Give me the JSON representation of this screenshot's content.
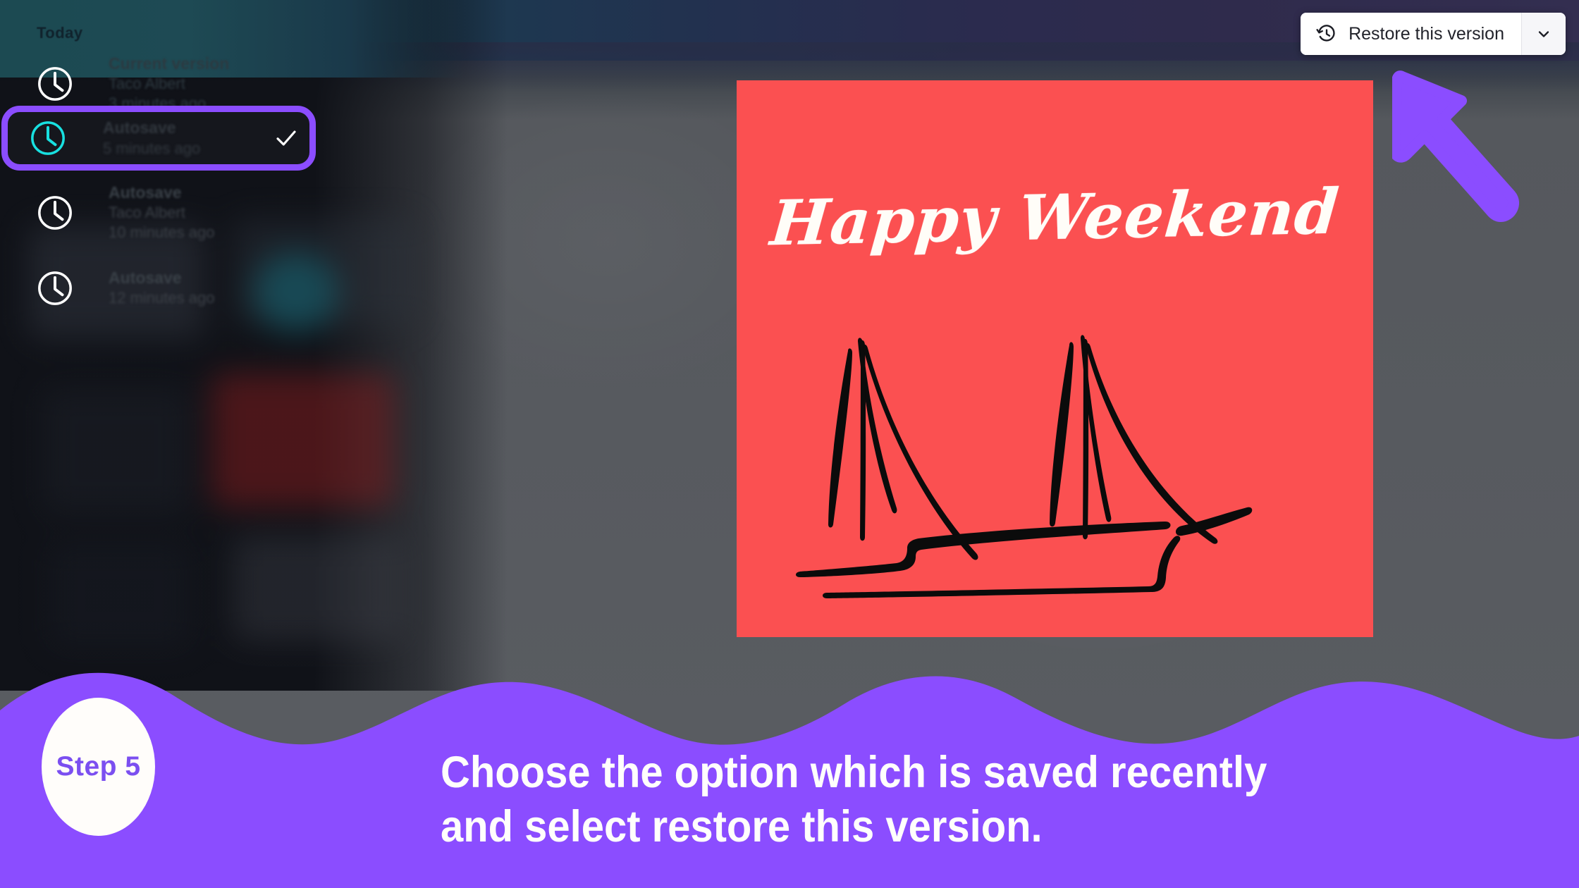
{
  "app": {
    "background_color": "#55585d",
    "accent_purple": "#8B4DFF",
    "poster_color": "#FB5051",
    "highlight_cyan": "#18E0E0"
  },
  "panel": {
    "section_label": "Today",
    "versions": [
      {
        "title": "Current version",
        "author": "Taco Albert",
        "time": "3 minutes ago",
        "icon": "clock-icon",
        "selected": false
      },
      {
        "title": "Autosave",
        "author": "",
        "time": "5 minutes ago",
        "icon": "clock-icon",
        "selected": true,
        "check": "check-icon"
      },
      {
        "title": "Autosave",
        "author": "Taco Albert",
        "time": "10 minutes ago",
        "icon": "clock-icon",
        "selected": false
      },
      {
        "title": "Autosave",
        "author": "",
        "time": "12 minutes ago",
        "icon": "clock-icon",
        "selected": false
      }
    ]
  },
  "toolbar": {
    "restore_label": "Restore this version",
    "restore_icon": "history-restore-icon",
    "dropdown_icon": "chevron-down-icon"
  },
  "poster": {
    "heading": "Happy Weekend",
    "illustration": "sailboat-line-art"
  },
  "annotation": {
    "pointer_icon": "arrow-pointer-up-left",
    "step_badge": "Step 5",
    "caption_line1": "Choose the option which is saved recently",
    "caption_line2": "and select restore this version."
  }
}
